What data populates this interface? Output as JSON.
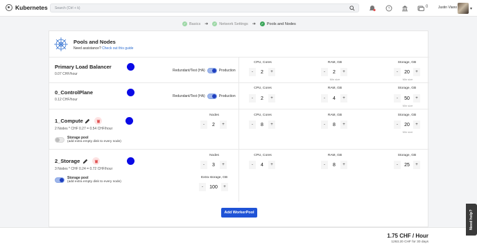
{
  "app": {
    "name": "Kubernetes",
    "logo_icon": "kubernetes-logo-icon"
  },
  "header": {
    "search_placeholder": "Search (Ctrl + k)",
    "user_name": "Justin Viano",
    "badge_count": "0"
  },
  "steps": [
    {
      "label": "Basics",
      "state": "done"
    },
    {
      "label": "Network Settings",
      "state": "done"
    },
    {
      "label": "Pools and Nodes",
      "state": "active"
    }
  ],
  "page": {
    "title": "Pools and Nodes",
    "assist_text": "Need assistance?",
    "assist_link": "Check out this guide"
  },
  "pools": [
    {
      "name": "Primary Load Balancer",
      "price": "0.07 CHF/hour",
      "mode_label": "Redundant/Test (HA)",
      "mode_value": "Production",
      "cpu_label": "CPU, Cores",
      "cpu": "2",
      "ram_label": "RAM, GB",
      "ram": "2",
      "ram_sub": "Min size",
      "storage_label": "Storage, GB",
      "storage": "20",
      "storage_sub": "Min size"
    },
    {
      "name": "0_ControlPlane",
      "price": "0.12 CHF/hour",
      "mode_label": "Redundant/Test (HA)",
      "mode_value": "Production",
      "cpu_label": "CPU, Cores",
      "cpu": "2",
      "ram_label": "RAM, GB",
      "ram": "4",
      "storage_label": "Storage, GB",
      "storage": "50",
      "storage_sub": "Min size"
    },
    {
      "name": "1_Compute",
      "price": "2 Nodes * CHF 0.27 = 0.54 CHF/hour",
      "nodes_label": "Nodes",
      "nodes": "2",
      "cpu_label": "CPU, Cores",
      "cpu": "8",
      "ram_label": "RAM, GB",
      "ram": "8",
      "storage_label": "Storage, GB",
      "storage": "20",
      "storage_sub": "Min size",
      "pool_title": "Storage pool",
      "pool_desc": "(add extra empty disk to every node)",
      "pool_enabled": false
    },
    {
      "name": "2_Storage",
      "price": "3 Nodes * CHF 0.24 = 0.72 CHF/hour",
      "nodes_label": "Nodes",
      "nodes": "3",
      "cpu_label": "CPU, Cores",
      "cpu": "4",
      "ram_label": "RAM, GB",
      "ram": "8",
      "storage_label": "Storage, GB",
      "storage": "25",
      "pool_title": "Storage pool",
      "pool_desc": "(add extra empty disk to every node)",
      "pool_enabled": true,
      "extra_label": "Extra storage, GB",
      "extra": "100"
    }
  ],
  "stepper": {
    "minus": "-",
    "plus": "+"
  },
  "add_button": "Add WorkerPool",
  "footer": {
    "total": "1.75 CHF / Hour",
    "total_30": "1263.20 CHF for 30 days"
  },
  "help_tab": "Need help?",
  "colors": {
    "accent": "#1f53d6",
    "pool_dot": "#0a0ae6",
    "success": "#3aa55a",
    "danger": "#e05252"
  }
}
